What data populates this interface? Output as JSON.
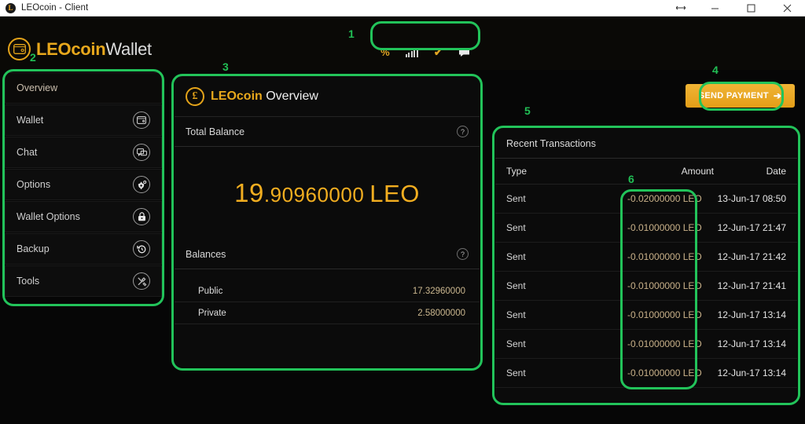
{
  "window": {
    "title": "LEOcoin - Client",
    "app_icon": "leocoin-icon",
    "controls": {
      "resize": "resize-icon",
      "minimize": "minimize-icon",
      "maximize": "maximize-icon",
      "close": "close-icon"
    }
  },
  "header": {
    "brand_bold": "LEOcoin",
    "brand_light": "Wallet",
    "toolbar": {
      "items": [
        {
          "name": "percent-icon",
          "glyph": "%"
        },
        {
          "name": "signal-bars-icon",
          "glyph": "signal"
        },
        {
          "name": "check-icon",
          "glyph": "✔"
        },
        {
          "name": "chat-bubble-icon",
          "glyph": "chat"
        }
      ]
    }
  },
  "sidebar": {
    "items": [
      {
        "label": "Overview",
        "icon": "",
        "active": true
      },
      {
        "label": "Wallet",
        "icon": "wallet-icon",
        "active": false
      },
      {
        "label": "Chat",
        "icon": "chat-icon",
        "active": false
      },
      {
        "label": "Options",
        "icon": "gear-icon",
        "active": false
      },
      {
        "label": "Wallet Options",
        "icon": "lock-icon",
        "active": false
      },
      {
        "label": "Backup",
        "icon": "history-icon",
        "active": false
      },
      {
        "label": "Tools",
        "icon": "tools-icon",
        "active": false
      }
    ]
  },
  "overview": {
    "coin_icon": "leocoin-coin-icon",
    "title_bold": "LEOcoin",
    "title_light": "Overview",
    "total_balance_label": "Total Balance",
    "help_icon": "help-icon",
    "balance": {
      "integer": "19",
      "decimal": ".90960000",
      "unit": "LEO"
    },
    "balances_label": "Balances",
    "rows": [
      {
        "label": "Public",
        "value": "17.32960000"
      },
      {
        "label": "Private",
        "value": "2.58000000"
      }
    ]
  },
  "send_payment": {
    "label": "SEND PAYMENT",
    "arrow": "➔",
    "color": "#efb133"
  },
  "transactions": {
    "title": "Recent Transactions",
    "columns": {
      "type": "Type",
      "amount": "Amount",
      "date": "Date"
    },
    "rows": [
      {
        "type": "Sent",
        "amount": "-0.02000000 LEO",
        "date": "13-Jun-17 08:50"
      },
      {
        "type": "Sent",
        "amount": "-0.01000000 LEO",
        "date": "12-Jun-17 21:47"
      },
      {
        "type": "Sent",
        "amount": "-0.01000000 LEO",
        "date": "12-Jun-17 21:42"
      },
      {
        "type": "Sent",
        "amount": "-0.01000000 LEO",
        "date": "12-Jun-17 21:41"
      },
      {
        "type": "Sent",
        "amount": "-0.01000000 LEO",
        "date": "12-Jun-17 13:14"
      },
      {
        "type": "Sent",
        "amount": "-0.01000000 LEO",
        "date": "12-Jun-17 13:14"
      },
      {
        "type": "Sent",
        "amount": "-0.01000000 LEO",
        "date": "12-Jun-17 13:14"
      }
    ]
  },
  "annotations": {
    "color": "#21bf55",
    "labels": [
      "1",
      "2",
      "3",
      "4",
      "5",
      "6"
    ]
  }
}
